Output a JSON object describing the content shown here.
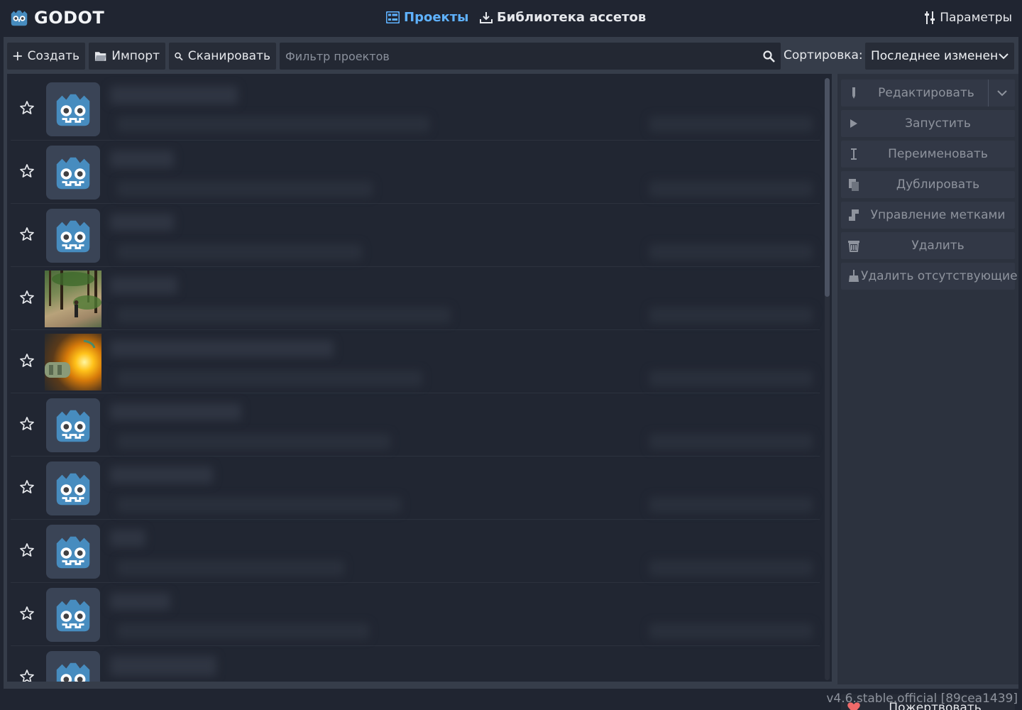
{
  "app": {
    "logo_text": "GODOT",
    "version": "v4.6.stable.official [89cea1439]"
  },
  "nav": {
    "projects_label": "Проекты",
    "asset_library_label": "Библиотека ассетов",
    "settings_label": "Параметры"
  },
  "toolbar": {
    "create_label": "Создать",
    "import_label": "Импорт",
    "scan_label": "Сканировать",
    "filter_placeholder": "Фильтр проектов",
    "sort_label": "Сортировка:",
    "sort_value": "Последнее изменен"
  },
  "projects": [
    {
      "thumb": "godot-icon"
    },
    {
      "thumb": "godot-icon"
    },
    {
      "thumb": "godot-icon"
    },
    {
      "thumb": "forest-screenshot"
    },
    {
      "thumb": "machine-screenshot"
    },
    {
      "thumb": "godot-icon"
    },
    {
      "thumb": "godot-icon"
    },
    {
      "thumb": "godot-icon"
    },
    {
      "thumb": "godot-icon"
    },
    {
      "thumb": "godot-icon"
    }
  ],
  "actions": {
    "edit": "Редактировать",
    "run": "Запустить",
    "rename": "Переименовать",
    "duplicate": "Дублировать",
    "manage_tags": "Управление метками",
    "remove": "Удалить",
    "remove_missing": "Удалить отсутствующие",
    "donate": "Пожертвовать"
  },
  "colors": {
    "accent": "#5fb2ff",
    "background": "#202531",
    "panel": "#363d4a",
    "donate_heart": "#f06a6a",
    "godot_blue": "#478cbf"
  }
}
